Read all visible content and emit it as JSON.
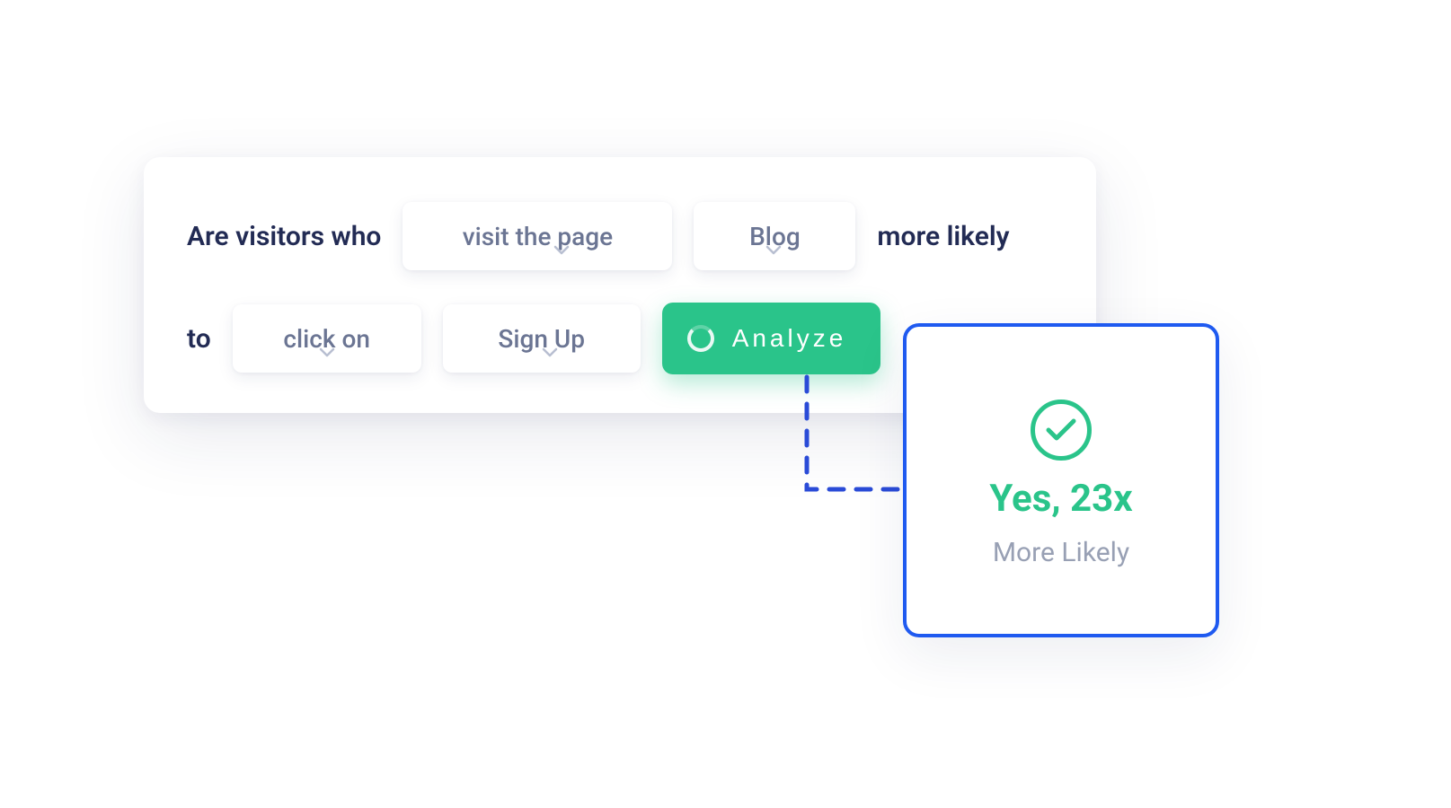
{
  "query": {
    "text_prefix": "Are visitors who",
    "action_dropdown": "visit the page",
    "page_dropdown": "Blog",
    "text_middle": "more likely",
    "text_to": "to",
    "event_dropdown": "click on",
    "target_dropdown": "Sign Up",
    "analyze_label": "Analyze"
  },
  "result": {
    "headline": "Yes, 23x",
    "subtext": "More Likely"
  },
  "colors": {
    "accent_green": "#2ac48a",
    "accent_blue": "#1f5af0",
    "text_dark": "#222b54",
    "text_muted": "#6b7593"
  }
}
